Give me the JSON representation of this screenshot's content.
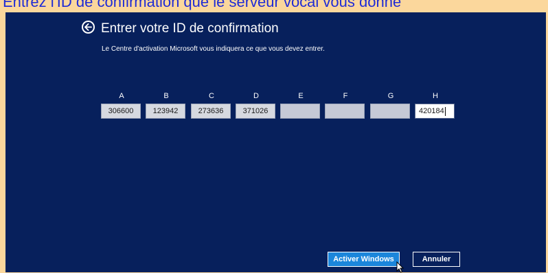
{
  "caption": "Entrez l'ID de confirmation que le serveur vocal vous donne",
  "header": {
    "title": "Entrer votre ID de confirmation",
    "subtitle": "Le Centre d'activation Microsoft vous indiquera ce que vous devez entrer."
  },
  "confirmation": {
    "labels": [
      "A",
      "B",
      "C",
      "D",
      "E",
      "F",
      "G",
      "H"
    ],
    "values": [
      "306600",
      "123942",
      "273636",
      "371026",
      "",
      "",
      "",
      "420184"
    ]
  },
  "buttons": {
    "activate": "Activer Windows",
    "cancel": "Annuler"
  },
  "colors": {
    "background": "#07205c",
    "primary": "#1b86db",
    "caption": "#1f2bd6",
    "frame": "#fbd79c"
  },
  "icons": {
    "back": "back-arrow-circle-icon",
    "pointer": "mouse-pointer-icon"
  }
}
